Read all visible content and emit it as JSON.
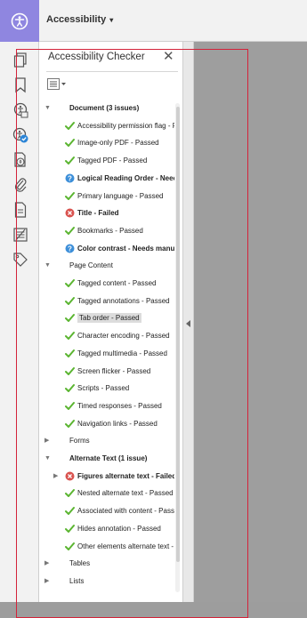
{
  "toolbar": {
    "title": "Accessibility",
    "caret": "▾",
    "icon": "accessibility-icon",
    "accent_color": "#8f86e0"
  },
  "rail": {
    "icons": [
      "pages-icon",
      "bookmark-icon",
      "accessibility-tags-icon",
      "accessibility-checker-icon",
      "content-order-icon",
      "attachments-icon",
      "document-properties-icon",
      "order-icon",
      "tags-icon"
    ],
    "active_index": 3
  },
  "panel": {
    "title": "Accessibility Checker",
    "close_glyph": "✕",
    "options_icon": "options-menu-icon"
  },
  "tree": [
    {
      "text": "Document (3 issues)",
      "level": 0,
      "twisty": "open",
      "status": "none",
      "bold": true
    },
    {
      "text": "Accessibility permission flag - F",
      "level": 1,
      "twisty": "none",
      "status": "passed",
      "bold": false
    },
    {
      "text": "Image-only PDF - Passed",
      "level": 1,
      "twisty": "none",
      "status": "passed",
      "bold": false
    },
    {
      "text": "Tagged PDF - Passed",
      "level": 1,
      "twisty": "none",
      "status": "passed",
      "bold": false
    },
    {
      "text": "Logical Reading Order - Need",
      "level": 1,
      "twisty": "none",
      "status": "manual",
      "bold": true
    },
    {
      "text": "Primary language - Passed",
      "level": 1,
      "twisty": "none",
      "status": "passed",
      "bold": false
    },
    {
      "text": "Title - Failed",
      "level": 1,
      "twisty": "none",
      "status": "failed",
      "bold": true
    },
    {
      "text": "Bookmarks - Passed",
      "level": 1,
      "twisty": "none",
      "status": "passed",
      "bold": false
    },
    {
      "text": "Color contrast - Needs manu",
      "level": 1,
      "twisty": "none",
      "status": "manual",
      "bold": true
    },
    {
      "text": "Page Content",
      "level": 0,
      "twisty": "open",
      "status": "none",
      "bold": false
    },
    {
      "text": "Tagged content - Passed",
      "level": 1,
      "twisty": "none",
      "status": "passed",
      "bold": false
    },
    {
      "text": "Tagged annotations - Passed",
      "level": 1,
      "twisty": "none",
      "status": "passed",
      "bold": false
    },
    {
      "text": "Tab order - Passed",
      "level": 1,
      "twisty": "none",
      "status": "passed",
      "bold": false,
      "selected": true
    },
    {
      "text": "Character encoding - Passed",
      "level": 1,
      "twisty": "none",
      "status": "passed",
      "bold": false
    },
    {
      "text": "Tagged multimedia - Passed",
      "level": 1,
      "twisty": "none",
      "status": "passed",
      "bold": false
    },
    {
      "text": "Screen flicker - Passed",
      "level": 1,
      "twisty": "none",
      "status": "passed",
      "bold": false
    },
    {
      "text": "Scripts - Passed",
      "level": 1,
      "twisty": "none",
      "status": "passed",
      "bold": false
    },
    {
      "text": "Timed responses - Passed",
      "level": 1,
      "twisty": "none",
      "status": "passed",
      "bold": false
    },
    {
      "text": "Navigation links - Passed",
      "level": 1,
      "twisty": "none",
      "status": "passed",
      "bold": false
    },
    {
      "text": "Forms",
      "level": 0,
      "twisty": "closed",
      "status": "none",
      "bold": false
    },
    {
      "text": "Alternate Text (1 issue)",
      "level": 0,
      "twisty": "open",
      "status": "none",
      "bold": true
    },
    {
      "text": "Figures alternate text - Failed",
      "level": 1,
      "twisty": "closed",
      "status": "failed",
      "bold": true
    },
    {
      "text": "Nested alternate text - Passed",
      "level": 1,
      "twisty": "none",
      "status": "passed",
      "bold": false
    },
    {
      "text": "Associated with content - Pass",
      "level": 1,
      "twisty": "none",
      "status": "passed",
      "bold": false
    },
    {
      "text": "Hides annotation - Passed",
      "level": 1,
      "twisty": "none",
      "status": "passed",
      "bold": false
    },
    {
      "text": "Other elements alternate text -",
      "level": 1,
      "twisty": "none",
      "status": "passed",
      "bold": false
    },
    {
      "text": "Tables",
      "level": 0,
      "twisty": "closed",
      "status": "none",
      "bold": false
    },
    {
      "text": "Lists",
      "level": 0,
      "twisty": "closed",
      "status": "none",
      "bold": false
    }
  ],
  "colors": {
    "passed": "#5bb531",
    "failed": "#d9534f",
    "manual": "#3d8fd9",
    "outline": "#d4233a"
  }
}
